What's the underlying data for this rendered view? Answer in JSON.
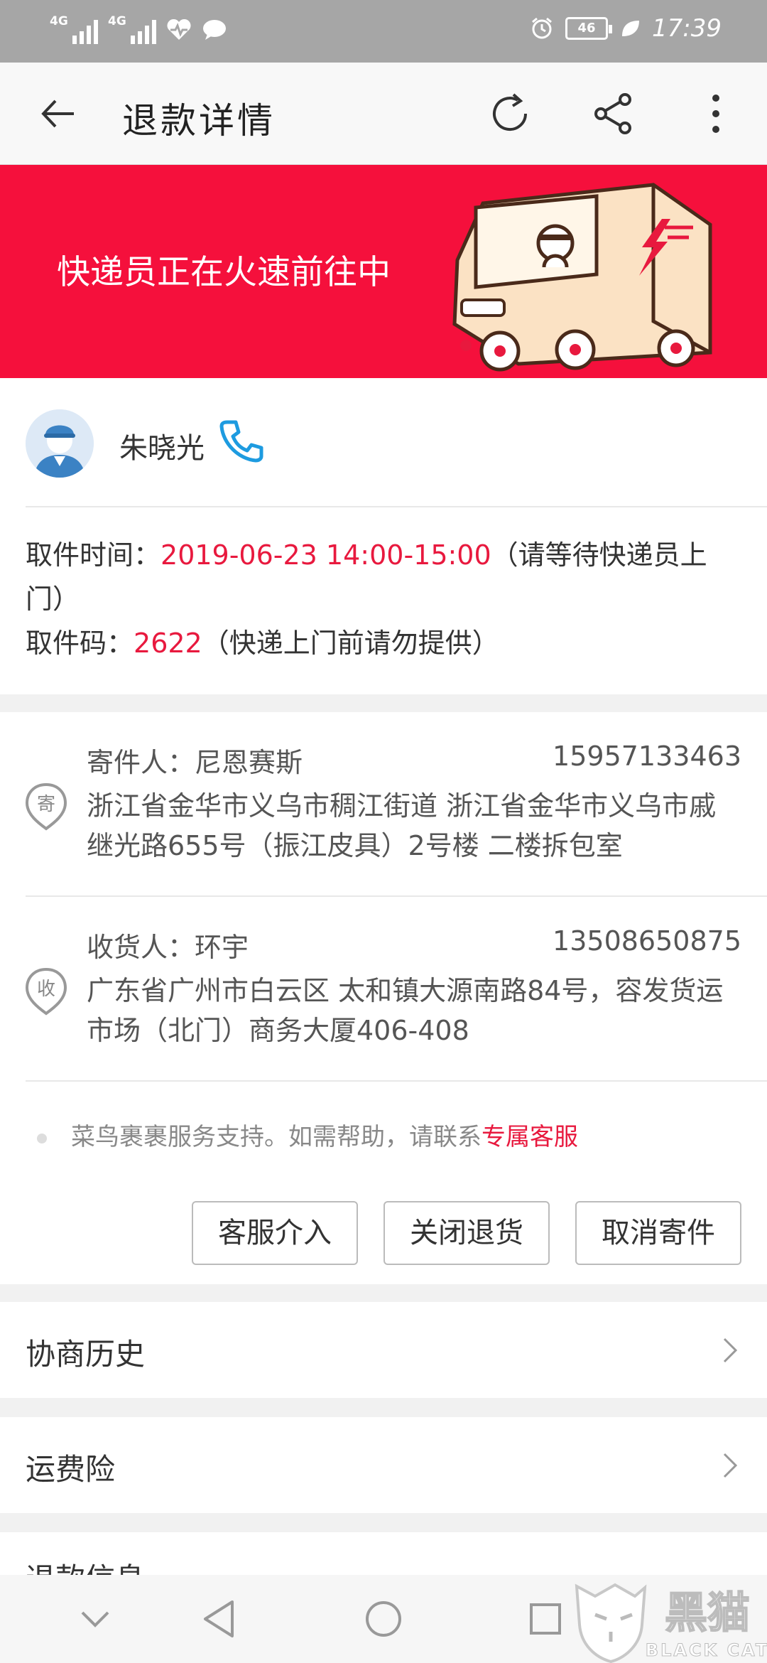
{
  "status_bar": {
    "signal1": "4G",
    "signal2": "4G",
    "battery": "46",
    "time": "17:39"
  },
  "toolbar": {
    "title": "退款详情"
  },
  "banner": {
    "text": "快递员正在火速前往中"
  },
  "courier": {
    "name": "朱晓光",
    "pickup_time_label": "取件时间：",
    "pickup_time_value": "2019-06-23 14:00-15:00",
    "pickup_time_note": "（请等待快递员上门）",
    "pickup_code_label": "取件码：",
    "pickup_code_value": "2622",
    "pickup_code_note": "（快递上门前请勿提供）"
  },
  "sender": {
    "label": "寄件人：尼恩赛斯",
    "phone": "15957133463",
    "address": "浙江省金华市义乌市稠江街道 浙江省金华市义乌市戚继光路655号（振江皮具）2号楼 二楼拆包室",
    "icon_char": "寄"
  },
  "receiver": {
    "label": "收货人：环宇",
    "phone": "13508650875",
    "address": "广东省广州市白云区 太和镇大源南路84号，容发货运市场（北门）商务大厦406-408",
    "icon_char": "收"
  },
  "notice": {
    "text": "菜鸟裹裹服务支持。如需帮助，请联系",
    "link": "专属客服"
  },
  "actions": [
    "客服介入",
    "关闭退货",
    "取消寄件"
  ],
  "menu": [
    "协商历史",
    "运费险",
    "退款信息"
  ],
  "watermark": {
    "cn": "黑猫",
    "en": "BLACK CAT"
  },
  "colors": {
    "accent_red": "#e8193e",
    "banner_red": "#f5103c",
    "phone_blue": "#1d9be0"
  }
}
